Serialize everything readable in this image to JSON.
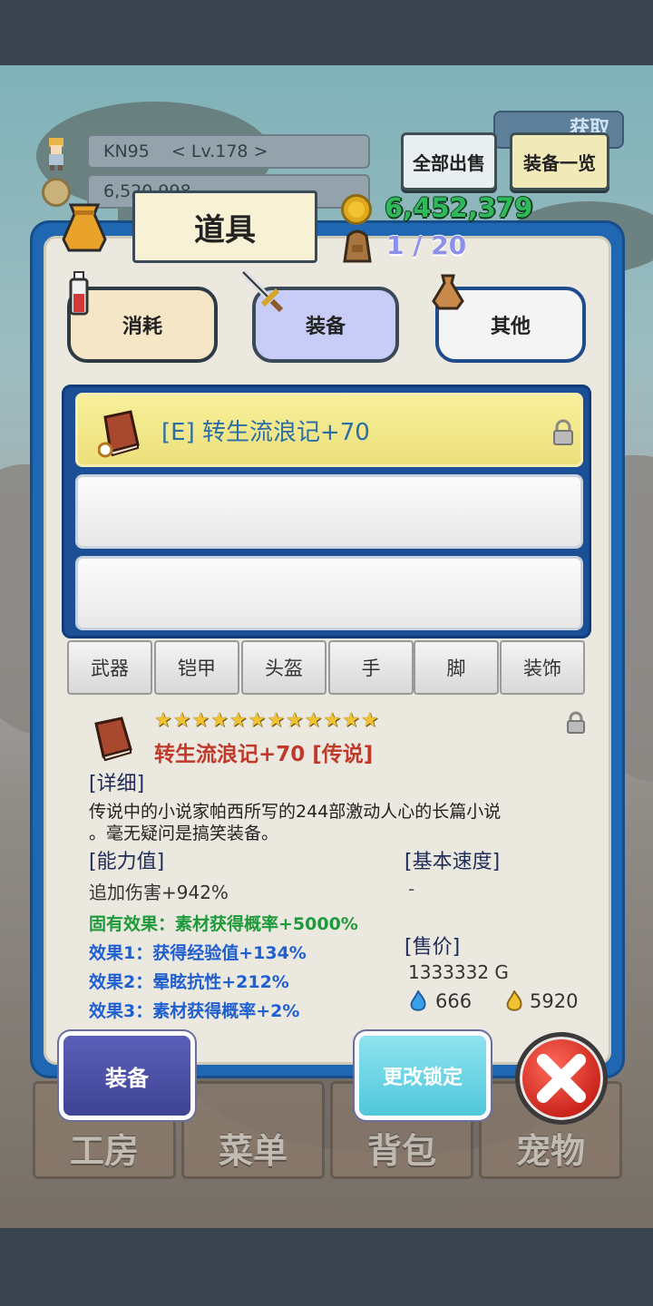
{
  "hud": {
    "player_name": "KN95",
    "player_level": "< Lv.178 >",
    "gold_partial": "6,520,998",
    "logo_text": "获取"
  },
  "top_buttons": {
    "sell_all": "全部出售",
    "equipment_list": "装备一览"
  },
  "panel": {
    "title": "道具",
    "gold": "6,452,379",
    "capacity": "1 / 20"
  },
  "tabs": [
    {
      "label": "消耗",
      "active": false
    },
    {
      "label": "装备",
      "active": true
    },
    {
      "label": "其他",
      "active": false
    }
  ],
  "slots": [
    {
      "label": "[E] 转生流浪记+70",
      "selected": true,
      "locked": true
    },
    {
      "label": "",
      "selected": false
    },
    {
      "label": "",
      "selected": false
    }
  ],
  "categories": [
    "武器",
    "铠甲",
    "头盔",
    "手",
    "脚",
    "装饰"
  ],
  "detail": {
    "stars": "★★★★★★★★★★★★",
    "name": "转生流浪记+70 [传说]",
    "detail_header": "[详细]",
    "description_line1": "传说中的小说家帕西所写的244部激动人心的长篇小说",
    "description_line2": "。毫无疑问是搞笑装备。",
    "ability_header": "[能力值]",
    "ability_value": "追加伤害+942%",
    "speed_header": "[基本速度]",
    "speed_value": "-",
    "innate_effect": "固有效果：素材获得概率+5000%",
    "effect1": "效果1：获得经验值+134%",
    "effect2": "效果2：晕眩抗性+212%",
    "effect3": "效果3：素材获得概率+2%",
    "price_header": "[售价]",
    "price_value": "1333332 G",
    "crystal_value": "666",
    "drop_value": "5920"
  },
  "actions": {
    "equip": "装备",
    "change_lock": "更改锁定"
  },
  "nav": [
    "工房",
    "菜单",
    "背包",
    "宠物"
  ],
  "colors": {
    "panel_blue": "#1f67b2",
    "selected_slot": "#f2e88c",
    "legendary_red": "#c0392b",
    "innate_green": "#1e9a3a",
    "effect_blue": "#1f5fd0"
  }
}
